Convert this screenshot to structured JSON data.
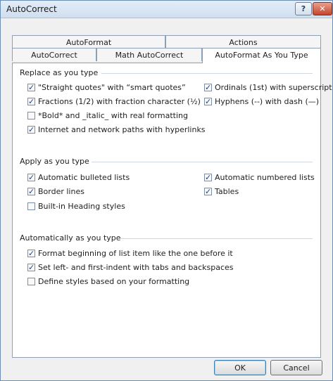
{
  "window": {
    "title": "AutoCorrect",
    "help_glyph": "?",
    "close_glyph": "✕"
  },
  "tabs": {
    "row1": [
      {
        "label": "AutoFormat"
      },
      {
        "label": "Actions"
      }
    ],
    "row2": [
      {
        "label": "AutoCorrect"
      },
      {
        "label": "Math AutoCorrect"
      },
      {
        "label": "AutoFormat As You Type",
        "active": true
      }
    ]
  },
  "sections": {
    "replace": {
      "title": "Replace as you type",
      "options": [
        {
          "label": "\"Straight quotes\" with “smart quotes”",
          "checked": true
        },
        {
          "label": "Ordinals (1st) with superscript",
          "checked": true
        },
        {
          "label": "Fractions (1/2) with fraction character (½)",
          "checked": true
        },
        {
          "label": "Hyphens (--) with dash (—)",
          "checked": true
        },
        {
          "label": "*Bold* and _italic_ with real formatting",
          "checked": false
        },
        {
          "label": "Internet and network paths with hyperlinks",
          "checked": true
        }
      ]
    },
    "apply": {
      "title": "Apply as you type",
      "options": [
        {
          "label": "Automatic bulleted lists",
          "checked": true
        },
        {
          "label": "Automatic numbered lists",
          "checked": true
        },
        {
          "label": "Border lines",
          "checked": true
        },
        {
          "label": "Tables",
          "checked": true
        },
        {
          "label": "Built-in Heading styles",
          "checked": false
        }
      ]
    },
    "auto": {
      "title": "Automatically as you type",
      "options": [
        {
          "label": "Format beginning of list item like the one before it",
          "checked": true
        },
        {
          "label": "Set left- and first-indent with tabs and backspaces",
          "checked": true
        },
        {
          "label": "Define styles based on your formatting",
          "checked": false
        }
      ]
    }
  },
  "buttons": {
    "ok": "OK",
    "cancel": "Cancel"
  }
}
